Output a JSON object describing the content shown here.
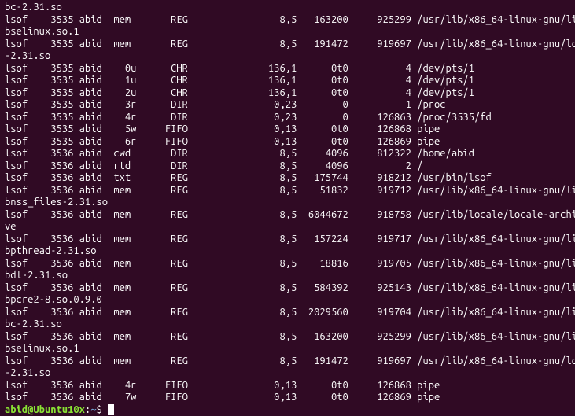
{
  "lines": [
    "bc-2.31.so",
    "lsof    3535 abid  mem       REG                8,5   163200     925299 /usr/lib/x86_64-linux-gnu/li",
    "bselinux.so.1",
    "lsof    3535 abid  mem       REG                8,5   191472     919697 /usr/lib/x86_64-linux-gnu/ld",
    "-2.31.so",
    "lsof    3535 abid    0u      CHR              136,1      0t0          4 /dev/pts/1",
    "lsof    3535 abid    1u      CHR              136,1      0t0          4 /dev/pts/1",
    "lsof    3535 abid    2u      CHR              136,1      0t0          4 /dev/pts/1",
    "lsof    3535 abid    3r      DIR               0,23        0          1 /proc",
    "lsof    3535 abid    4r      DIR               0,23        0     126863 /proc/3535/fd",
    "lsof    3535 abid    5w     FIFO               0,13      0t0     126868 pipe",
    "lsof    3535 abid    6r     FIFO               0,13      0t0     126869 pipe",
    "lsof    3536 abid  cwd       DIR                8,5     4096     812322 /home/abid",
    "lsof    3536 abid  rtd       DIR                8,5     4096          2 /",
    "lsof    3536 abid  txt       REG                8,5   175744     918212 /usr/bin/lsof",
    "lsof    3536 abid  mem       REG                8,5    51832     919712 /usr/lib/x86_64-linux-gnu/li",
    "bnss_files-2.31.so",
    "lsof    3536 abid  mem       REG                8,5  6044672     918758 /usr/lib/locale/locale-archi",
    "ve",
    "lsof    3536 abid  mem       REG                8,5   157224     919717 /usr/lib/x86_64-linux-gnu/li",
    "bpthread-2.31.so",
    "lsof    3536 abid  mem       REG                8,5    18816     919705 /usr/lib/x86_64-linux-gnu/li",
    "bdl-2.31.so",
    "lsof    3536 abid  mem       REG                8,5   584392     925143 /usr/lib/x86_64-linux-gnu/li",
    "bpcre2-8.so.0.9.0",
    "lsof    3536 abid  mem       REG                8,5  2029560     919704 /usr/lib/x86_64-linux-gnu/li",
    "bc-2.31.so",
    "lsof    3536 abid  mem       REG                8,5   163200     925299 /usr/lib/x86_64-linux-gnu/li",
    "bselinux.so.1",
    "lsof    3536 abid  mem       REG                8,5   191472     919697 /usr/lib/x86_64-linux-gnu/ld",
    "-2.31.so",
    "lsof    3536 abid    4r     FIFO               0,13      0t0     126868 pipe",
    "lsof    3536 abid    7w     FIFO               0,13      0t0     126869 pipe"
  ],
  "prompt": {
    "user_host": "abid@Ubuntu10x",
    "separator": ":",
    "path": "~",
    "symbol": "$"
  }
}
